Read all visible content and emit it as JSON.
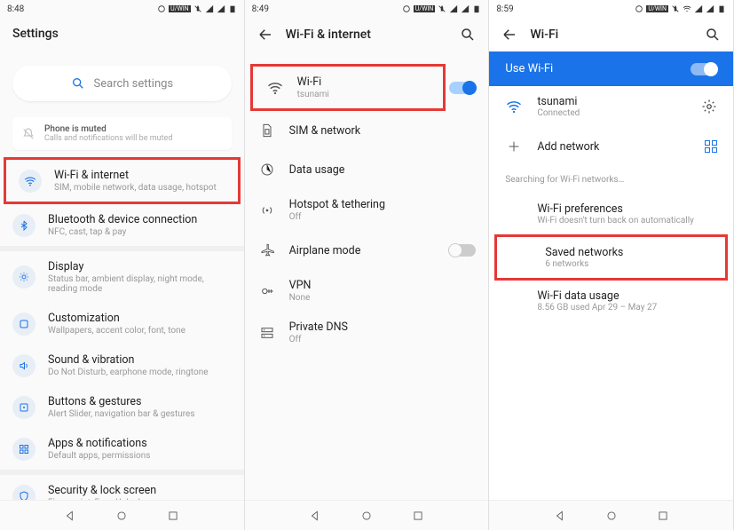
{
  "status": {
    "time1": "8:48",
    "time2": "8:49",
    "time3": "8:59"
  },
  "screen1": {
    "title": "Settings",
    "search_placeholder": "Search settings",
    "muted": {
      "title": "Phone is muted",
      "sub": "Calls and notifications will be muted"
    },
    "items": [
      {
        "title": "Wi-Fi & internet",
        "sub": "SIM, mobile network, data usage, hotspot"
      },
      {
        "title": "Bluetooth & device connection",
        "sub": "NFC, cast, tap & pay"
      },
      {
        "title": "Display",
        "sub": "Status bar, ambient display, night mode, reading mode"
      },
      {
        "title": "Customization",
        "sub": "Wallpapers, accent color, font, tone"
      },
      {
        "title": "Sound & vibration",
        "sub": "Do Not Disturb, earphone mode, ringtone"
      },
      {
        "title": "Buttons & gestures",
        "sub": "Alert Slider, navigation bar & gestures"
      },
      {
        "title": "Apps & notifications",
        "sub": "Default apps, permissions"
      },
      {
        "title": "Security & lock screen",
        "sub": "Fingerprint, Face Unlock, emergency rescue"
      }
    ]
  },
  "screen2": {
    "title": "Wi-Fi & internet",
    "items": [
      {
        "title": "Wi-Fi",
        "sub": "tsunami"
      },
      {
        "title": "SIM & network",
        "sub": ""
      },
      {
        "title": "Data usage",
        "sub": ""
      },
      {
        "title": "Hotspot & tethering",
        "sub": "Off"
      },
      {
        "title": "Airplane mode",
        "sub": ""
      },
      {
        "title": "VPN",
        "sub": "None"
      },
      {
        "title": "Private DNS",
        "sub": "Off"
      }
    ]
  },
  "screen3": {
    "title": "Wi-Fi",
    "use_wifi": "Use Wi-Fi",
    "network": {
      "title": "tsunami",
      "sub": "Connected"
    },
    "add": "Add network",
    "searching": "Searching for Wi-Fi networks…",
    "prefs": {
      "title": "Wi-Fi preferences",
      "sub": "Wi-Fi doesn't turn back on automatically"
    },
    "saved": {
      "title": "Saved networks",
      "sub": "6 networks"
    },
    "usage": {
      "title": "Wi-Fi data usage",
      "sub": "8.56 GB used Apr 29 – May 27"
    }
  }
}
